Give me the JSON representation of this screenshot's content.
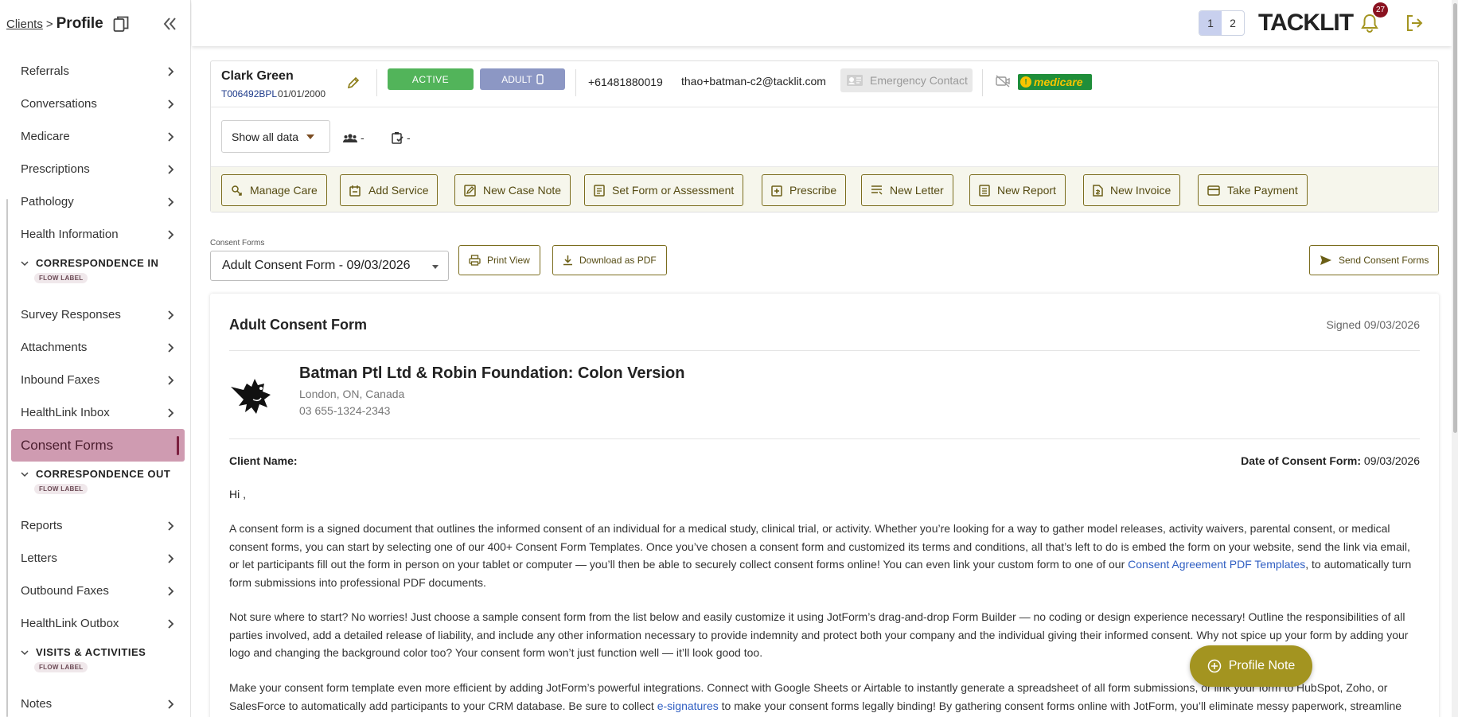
{
  "breadcrumb": {
    "parent": "Clients",
    "separator": ">",
    "current": "Profile"
  },
  "sidebar": {
    "items_top": [
      {
        "label": "Referrals"
      },
      {
        "label": "Conversations"
      },
      {
        "label": "Medicare"
      },
      {
        "label": "Prescriptions"
      },
      {
        "label": "Pathology"
      },
      {
        "label": "Health Information"
      }
    ],
    "section_in": {
      "title": "CORRESPONDENCE IN",
      "flow": "FLOW LABEL"
    },
    "items_in": [
      {
        "label": "Survey Responses"
      },
      {
        "label": "Attachments"
      },
      {
        "label": "Inbound Faxes"
      },
      {
        "label": "HealthLink Inbox"
      }
    ],
    "active_item": {
      "label": "Consent Forms"
    },
    "section_out": {
      "title": "CORRESPONDENCE OUT",
      "flow": "FLOW LABEL"
    },
    "items_out": [
      {
        "label": "Reports"
      },
      {
        "label": "Letters"
      },
      {
        "label": "Outbound Faxes"
      },
      {
        "label": "HealthLink Outbox"
      }
    ],
    "section_visits": {
      "title": "VISITS & ACTIVITIES",
      "flow": "FLOW LABEL"
    },
    "items_visits": [
      {
        "label": "Notes"
      }
    ]
  },
  "topbar": {
    "tabs": [
      "1",
      "2"
    ],
    "active_tab": "1",
    "brand": "TACKLIT",
    "notification_count": "27"
  },
  "client": {
    "name": "Clark Green",
    "id": "T006492BPL",
    "dob": "01/01/2000",
    "status": "ACTIVE",
    "type": "ADULT",
    "phone": "+61481880019",
    "email": "thao+batman-c2@tacklit.com",
    "emergency_label": "Emergency Contact",
    "medicare_label": "medicare",
    "show_data": "Show all data",
    "group_count": "-",
    "task_count": "-"
  },
  "actions": [
    {
      "label": "Manage Care",
      "icon": "care-icon"
    },
    {
      "label": "Add Service",
      "icon": "service-icon"
    },
    {
      "label": "New Case Note",
      "icon": "case-note-icon"
    },
    {
      "label": "Set Form or Assessment",
      "icon": "form-icon"
    },
    {
      "label": "Prescribe",
      "icon": "prescribe-icon"
    },
    {
      "label": "New Letter",
      "icon": "letter-icon"
    },
    {
      "label": "New Report",
      "icon": "report-icon"
    },
    {
      "label": "New Invoice",
      "icon": "invoice-icon"
    },
    {
      "label": "Take Payment",
      "icon": "payment-icon"
    }
  ],
  "consent": {
    "field_label": "Consent Forms",
    "selected": "Adult Consent Form - 09/03/2026",
    "print_label": "Print View",
    "download_label": "Download as PDF",
    "send_label": "Send Consent Forms"
  },
  "form": {
    "title": "Adult Consent Form",
    "signed": "Signed 09/03/2026",
    "org_name": "Batman Ptl Ltd & Robin Foundation: Colon Version",
    "org_address": "London, ON, Canada",
    "org_phone": "03 655-1324-2343",
    "client_name_label": "Client Name:",
    "date_label": "Date of Consent Form:",
    "date_value": "09/03/2026",
    "greeting": "Hi ,",
    "p1a": "A consent form is a signed document that outlines the informed consent of an individual for a medical study, clinical trial, or activity. Whether you’re looking for a way to gather model releases, activity waivers, parental consent, or medical consent forms, you can start by selecting one of our 400+ Consent Form Templates. Once you’ve chosen a consent form and customized its terms and conditions, all that’s left to do is embed the form on your website, send the link via email, or let participants fill out the form in person on your tablet or computer — you’ll then be able to securely collect consent forms online! You can even link your custom form to one of our ",
    "p1_link": "Consent Agreement PDF Templates",
    "p1b": ", to automatically turn form submissions into professional PDF documents.",
    "p2": "Not sure where to start? No worries! Just choose a sample consent form from the list below and easily customize it using JotForm’s drag-and-drop Form Builder — no coding or design experience necessary! Outline the responsibilities of all parties involved, add a detailed release of liability, and include any other information necessary to provide indemnity and protect both your company and the individual giving their informed consent. Why not spice up your form by adding your logo and changing the background color too? Your consent form won’t just function well — it’ll look good too.",
    "p3a": "Make your consent form template even more efficient by adding JotForm’s powerful integrations. Connect with Google Sheets or Airtable to instantly generate a spreadsheet of all form submissions, or link your form to HubSpot, Zoho, or SalesForce to automatically add participants to your CRM database. Be sure to collect ",
    "p3_link": "e-signatures",
    "p3b": " to make your consent forms legally binding! By gathering consent forms online with JotForm, you’ll eliminate messy paperwork, streamline"
  },
  "profile_note": {
    "label": "Profile Note"
  }
}
